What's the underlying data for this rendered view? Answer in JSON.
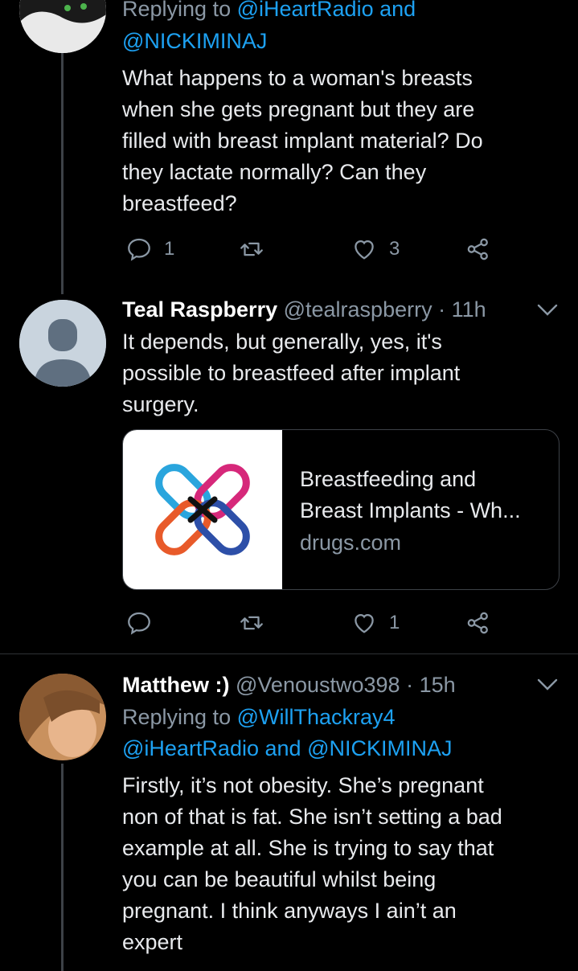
{
  "tweet1": {
    "replying_prefix": "Replying to",
    "replying_to_1": "@iHeartRadio",
    "replying_and": "and",
    "replying_to_2": "@NICKIMINAJ",
    "body_lines": [
      "What happens to a woman's breasts",
      "when she gets pregnant but they are",
      "filled with breast implant material? Do",
      "they lactate normally? Can they",
      "breastfeed?"
    ],
    "reply_count": "1",
    "like_count": "3"
  },
  "tweet2": {
    "display_name": "Teal Raspberry",
    "handle": "@tealraspberry",
    "separator": "·",
    "time": "11h",
    "body_lines": [
      "It depends, but generally, yes, it's",
      "possible to breastfeed after implant",
      "surgery."
    ],
    "card": {
      "title_lines": [
        "Breastfeeding and",
        "Breast Implants - Wh..."
      ],
      "domain": "drugs.com"
    },
    "like_count": "1"
  },
  "tweet3": {
    "display_name": "Matthew :)",
    "handle": "@Venoustwo398",
    "separator": "·",
    "time": "15h",
    "replying_prefix": "Replying to",
    "replying_to_1": "@WillThackray4",
    "replying_to_2": "@iHeartRadio",
    "replying_and": "and",
    "replying_to_3": "@NICKIMINAJ",
    "body_lines": [
      "Firstly, it’s not obesity. She’s pregnant",
      "non of that is fat. She isn’t setting a bad",
      "example at all. She is trying to say that",
      "you can be beautiful whilst being",
      "pregnant. I think anyways I ain’t an",
      "expert"
    ]
  },
  "colors": {
    "background": "#000000",
    "text": "#e8eaed",
    "muted": "#8b98a5",
    "link": "#1da1f2",
    "divider": "#2f3336"
  }
}
